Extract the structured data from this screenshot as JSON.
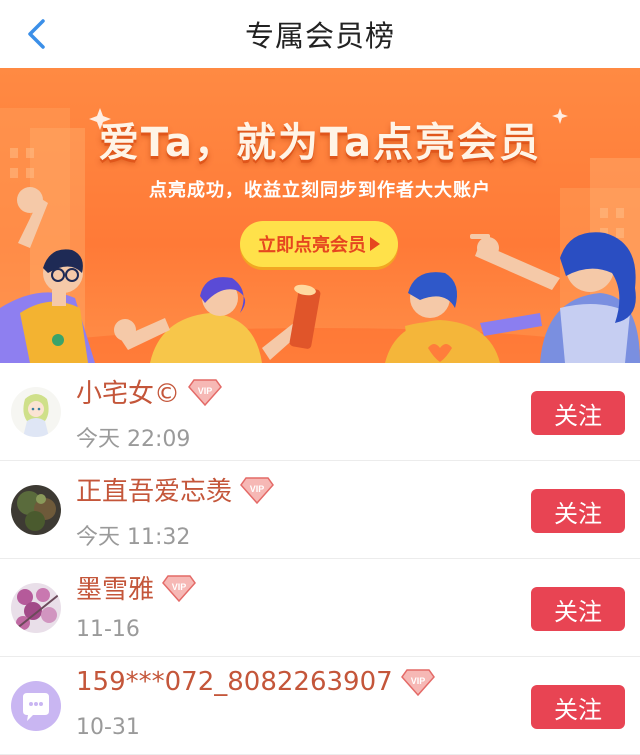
{
  "header": {
    "title": "专属会员榜"
  },
  "banner": {
    "headline": "爱Ta，就为Ta点亮会员",
    "subtitle": "点亮成功，收益立刻同步到作者大大账户",
    "cta_label": "立即点亮会员"
  },
  "members": [
    {
      "name": "小宅女©",
      "time": "今天 22:09",
      "badge": "VIP",
      "follow_label": "关注"
    },
    {
      "name": "正直吾爱忘羡",
      "time": "今天 11:32",
      "badge": "VIP",
      "follow_label": "关注"
    },
    {
      "name": "墨雪雅",
      "time": "11-16",
      "badge": "VIP",
      "follow_label": "关注"
    },
    {
      "name": "159***072_8082263907",
      "time": "10-31",
      "badge": "VIP",
      "follow_label": "关注"
    }
  ],
  "colors": {
    "accent_red": "#e84453",
    "name_color": "#c4563a",
    "back_arrow": "#3b8fe8",
    "banner_orange": "#ff7a37",
    "cta_yellow": "#ffe14a"
  }
}
